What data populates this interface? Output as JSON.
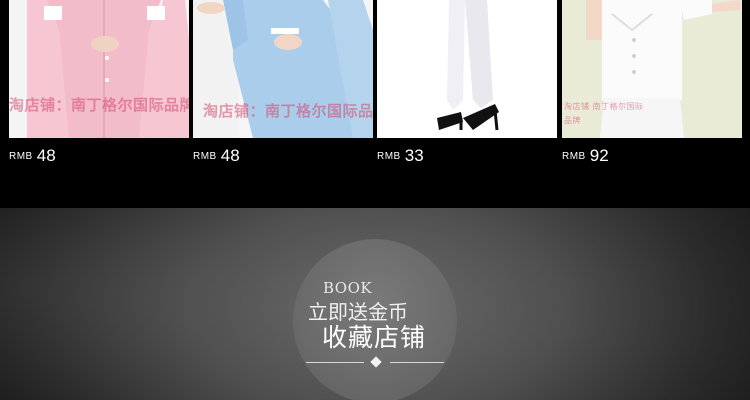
{
  "products": [
    {
      "currency": "RMB",
      "price": "48",
      "watermark": "淘店铺：南丁格尔国际品牌"
    },
    {
      "currency": "RMB",
      "price": "48",
      "watermark": "淘店铺：南丁格尔国际品牌"
    },
    {
      "currency": "RMB",
      "price": "33"
    },
    {
      "currency": "RMB",
      "price": "92",
      "watermark": "淘店铺 南丁格尔国际品牌"
    }
  ],
  "banner": {
    "book_label": "BOOK",
    "gift_label": "立即送金币",
    "favorite_label": "收藏店铺"
  },
  "colors": {
    "background": "#000000",
    "banner_center": "#6c6c6c",
    "circle": "#6a6a6a"
  }
}
